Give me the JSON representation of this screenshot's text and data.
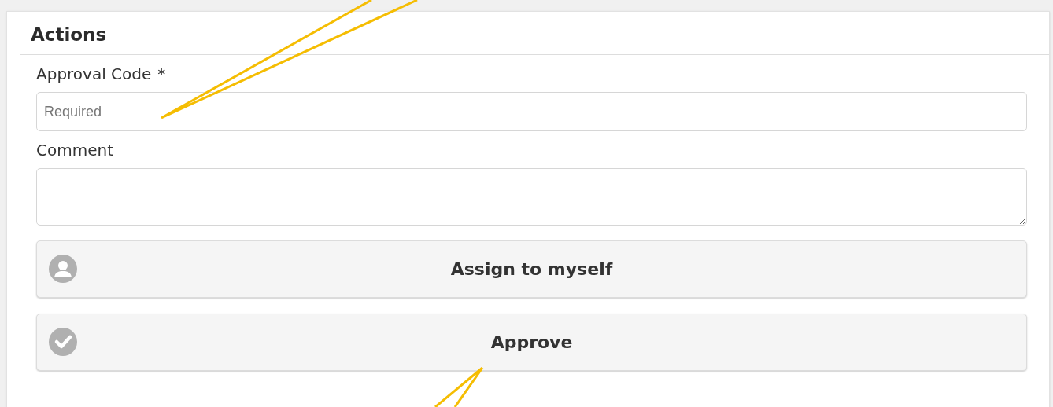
{
  "panel": {
    "title": "Actions"
  },
  "fields": [
    {
      "kind": "input",
      "label": "Approval Code",
      "required_mark": "*",
      "placeholder": "Required"
    },
    {
      "kind": "textarea",
      "label": "Comment"
    }
  ],
  "buttons": [
    {
      "kind": "assign",
      "label": "Assign to myself"
    },
    {
      "kind": "approve",
      "label": "Approve"
    }
  ]
}
